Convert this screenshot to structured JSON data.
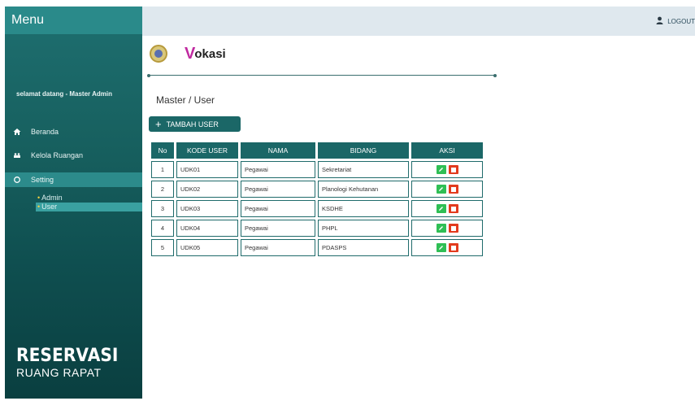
{
  "sidebar": {
    "menu_title": "Menu",
    "welcome": "selamat datang - Master Admin",
    "items": [
      {
        "label": "Beranda",
        "icon": "home-icon"
      },
      {
        "label": "Kelola Ruangan",
        "icon": "rooms-icon"
      },
      {
        "label": "Setting",
        "icon": "circle-icon"
      }
    ],
    "subitems": [
      {
        "label": "Admin"
      },
      {
        "label": "User"
      }
    ],
    "brand_line1": "RESERVASI",
    "brand_line2": "RUANG RAPAT"
  },
  "header": {
    "logout_label": "LOGOUT",
    "logout_icon": "user-icon"
  },
  "logos": {
    "vokasi_v": "V",
    "vokasi_text": "okasi"
  },
  "main": {
    "title": "Master / User",
    "add_button": "TAMBAH USER",
    "table": {
      "headers": [
        "No",
        "KODE USER",
        "NAMA",
        "BIDANG",
        "AKSI"
      ],
      "rows": [
        {
          "no": "1",
          "kode": "UDK01",
          "nama": "Pegawai",
          "bidang": "Sekretariat"
        },
        {
          "no": "2",
          "kode": "UDK02",
          "nama": "Pegawai",
          "bidang": "Planologi Kehutanan"
        },
        {
          "no": "3",
          "kode": "UDK03",
          "nama": "Pegawai",
          "bidang": "KSDHE"
        },
        {
          "no": "4",
          "kode": "UDK04",
          "nama": "Pegawai",
          "bidang": "PHPL"
        },
        {
          "no": "5",
          "kode": "UDK05",
          "nama": "Pegawai",
          "bidang": "PDASPS"
        }
      ]
    }
  },
  "colors": {
    "sidebar": "#17605f",
    "accent": "#1b6767",
    "edit": "#2fbf55",
    "delete": "#e23b1e"
  }
}
